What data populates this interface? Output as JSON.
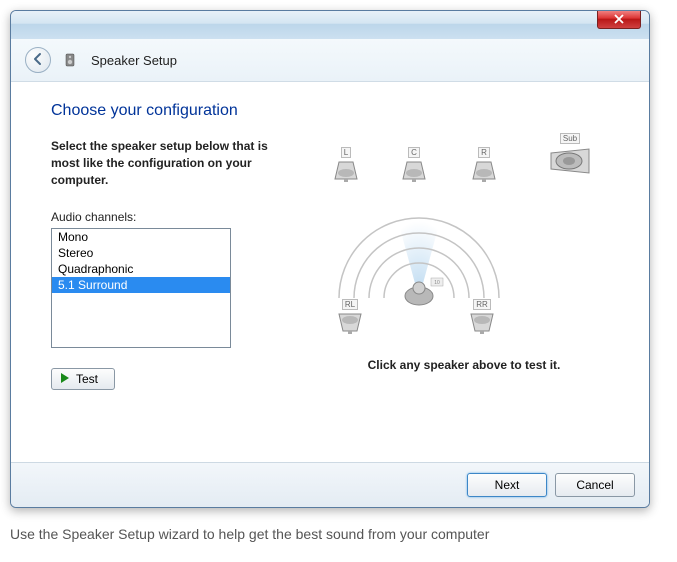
{
  "window": {
    "title": "Speaker Setup"
  },
  "page": {
    "heading": "Choose your configuration",
    "instruction": "Select the speaker setup below that is most like the configuration on your computer.",
    "channels_label": "Audio channels:",
    "channels": [
      {
        "label": "Mono",
        "selected": false
      },
      {
        "label": "Stereo",
        "selected": false
      },
      {
        "label": "Quadraphonic",
        "selected": false
      },
      {
        "label": "5.1 Surround",
        "selected": true
      }
    ],
    "test_button": "Test",
    "test_hint": "Click any speaker above to test it."
  },
  "speakers": {
    "sub": "Sub",
    "front_left": "L",
    "front_center": "C",
    "front_right": "R",
    "rear_left": "RL",
    "rear_right": "RR"
  },
  "footer": {
    "next": "Next",
    "cancel": "Cancel"
  },
  "caption": "Use the Speaker Setup wizard to help get the best sound from your computer"
}
